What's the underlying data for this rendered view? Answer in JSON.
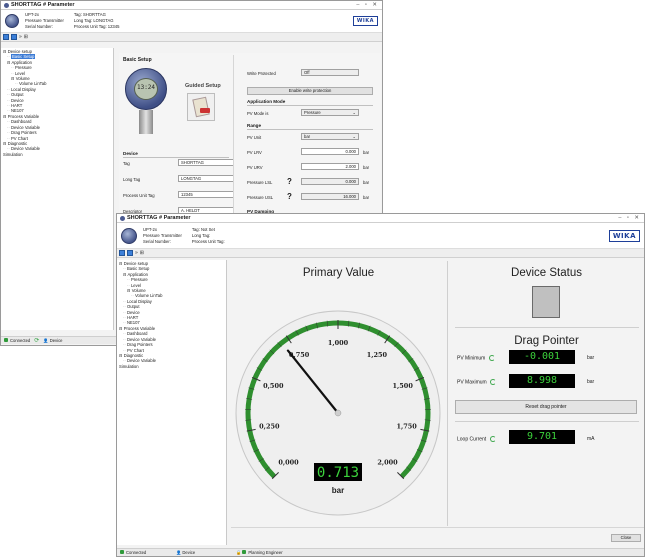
{
  "back_window": {
    "title": "SHORTTAG # Parameter",
    "header": {
      "model": "UPT-2x",
      "type": "Pressure Transmitter",
      "serial_label": "Serial Number:",
      "tag": "Tag: SHORTTAG",
      "long_tag": "Long Tag: LONGTAG",
      "process_unit_tag": "Process Unit Tag: 12345",
      "brand": "WIKA"
    },
    "tree": [
      {
        "label": "Device setup",
        "indent": 0,
        "prefix": "⊟"
      },
      {
        "label": "Basic Setup",
        "indent": 1,
        "prefix": "",
        "selected": true
      },
      {
        "label": "Application",
        "indent": 1,
        "prefix": "⊟"
      },
      {
        "label": "Pressure",
        "indent": 2,
        "prefix": ""
      },
      {
        "label": "Level",
        "indent": 2,
        "prefix": ""
      },
      {
        "label": "Volume",
        "indent": 2,
        "prefix": "⊟"
      },
      {
        "label": "Volume LinTab",
        "indent": 3,
        "prefix": ""
      },
      {
        "label": "Local Display",
        "indent": 1,
        "prefix": ""
      },
      {
        "label": "Output",
        "indent": 1,
        "prefix": ""
      },
      {
        "label": "Device",
        "indent": 1,
        "prefix": ""
      },
      {
        "label": "HART",
        "indent": 1,
        "prefix": ""
      },
      {
        "label": "NE107",
        "indent": 1,
        "prefix": ""
      },
      {
        "label": "Process Variable",
        "indent": 0,
        "prefix": "⊟"
      },
      {
        "label": "Dashboard",
        "indent": 1,
        "prefix": ""
      },
      {
        "label": "Device Variable",
        "indent": 1,
        "prefix": ""
      },
      {
        "label": "Drag Pointers",
        "indent": 1,
        "prefix": ""
      },
      {
        "label": "PV Chart",
        "indent": 1,
        "prefix": ""
      },
      {
        "label": "Diagnostic",
        "indent": 0,
        "prefix": "⊟"
      },
      {
        "label": "Device Variable",
        "indent": 1,
        "prefix": ""
      },
      {
        "label": "Simulation",
        "indent": 0,
        "prefix": ""
      }
    ],
    "basic_setup_title": "Basic Setup",
    "guided_setup_label": "Guided Setup",
    "device_section": "Device",
    "device_fields": [
      {
        "label": "Tag",
        "value": "SHORTTAG"
      },
      {
        "label": "Long Tag",
        "value": "LONGTAG"
      },
      {
        "label": "Process Unit Tag",
        "value": "12345"
      },
      {
        "label": "Descriptor",
        "value": "A. HELDT"
      }
    ],
    "write_protected_label": "Write Protected",
    "write_protected_value": "Off",
    "enable_write_protection": "Enable write protection",
    "app_mode_section": "Application Mode",
    "pv_mode_label": "PV Mode is",
    "pv_mode_value": "Pressure",
    "range_section": "Range",
    "range_fields": [
      {
        "label": "PV Unit",
        "value": "bar",
        "unit": "",
        "type": "select"
      },
      {
        "label": "PV LRV",
        "value": "0.000",
        "unit": "bar",
        "type": "input"
      },
      {
        "label": "PV URV",
        "value": "2.000",
        "unit": "bar",
        "type": "input"
      },
      {
        "label": "Pressure LSL",
        "value": "0.000",
        "unit": "bar",
        "type": "readonly"
      },
      {
        "label": "Pressure USL",
        "value": "16.000",
        "unit": "bar",
        "type": "readonly"
      }
    ],
    "pv_damping_label": "PV Damping",
    "lcd_value": "13:24",
    "status": {
      "connected": "Connected",
      "device": "Device"
    }
  },
  "front_window": {
    "title": "SHORTTAG # Parameter",
    "header": {
      "model": "UPT-2x",
      "type": "Pressure Transmitter",
      "serial_label": "Serial Number:",
      "tag": "Tag: Not Set",
      "long_tag": "Long Tag:",
      "process_unit_tag": "Process Unit Tag:",
      "brand": "WIKA"
    },
    "tree": [
      {
        "label": "Device setup",
        "indent": 0,
        "prefix": "⊟"
      },
      {
        "label": "Basic Setup",
        "indent": 1,
        "prefix": ""
      },
      {
        "label": "Application",
        "indent": 1,
        "prefix": "⊟"
      },
      {
        "label": "Pressure",
        "indent": 2,
        "prefix": ""
      },
      {
        "label": "Level",
        "indent": 2,
        "prefix": ""
      },
      {
        "label": "Volume",
        "indent": 2,
        "prefix": "⊟"
      },
      {
        "label": "Volume LinTab",
        "indent": 3,
        "prefix": ""
      },
      {
        "label": "Local Display",
        "indent": 1,
        "prefix": ""
      },
      {
        "label": "Output",
        "indent": 1,
        "prefix": ""
      },
      {
        "label": "Device",
        "indent": 1,
        "prefix": ""
      },
      {
        "label": "HART",
        "indent": 1,
        "prefix": ""
      },
      {
        "label": "NE107",
        "indent": 1,
        "prefix": ""
      },
      {
        "label": "Process Variable",
        "indent": 0,
        "prefix": "⊟"
      },
      {
        "label": "Dashboard",
        "indent": 1,
        "prefix": ""
      },
      {
        "label": "Device Variable",
        "indent": 1,
        "prefix": ""
      },
      {
        "label": "Drag Pointers",
        "indent": 1,
        "prefix": ""
      },
      {
        "label": "PV Chart",
        "indent": 1,
        "prefix": ""
      },
      {
        "label": "Diagnostic",
        "indent": 0,
        "prefix": "⊟"
      },
      {
        "label": "Device Variable",
        "indent": 1,
        "prefix": ""
      },
      {
        "label": "Simulation",
        "indent": 0,
        "prefix": ""
      }
    ],
    "gauge": {
      "title": "Primary Value",
      "value": 0.713,
      "value_text": "0.713",
      "unit": "bar",
      "min": 0,
      "max": 2,
      "tick_labels": [
        "0,000",
        "0,250",
        "0,500",
        "0,750",
        "1,000",
        "1,250",
        "1,500",
        "1,750",
        "2,000"
      ]
    },
    "device_status_title": "Device Status",
    "drag_pointer_title": "Drag Pointer",
    "pv_minimum_label": "PV Minimum",
    "pv_minimum_value": "-0.001",
    "pv_minimum_unit": "bar",
    "pv_maximum_label": "PV Maximum",
    "pv_maximum_value": "8.998",
    "pv_maximum_unit": "bar",
    "reset_label": "Reset drag pointer",
    "loop_current_label": "Loop Current",
    "loop_current_value": "9.701",
    "loop_current_unit": "mA",
    "close_label": "Close",
    "status": {
      "connected": "Connected",
      "device": "Device",
      "role": "Planning Engineer"
    },
    "colors": {
      "gauge_arc": "#2f8f2f",
      "digital_text": "#3cd33c",
      "status_box": "#c0c0c0"
    }
  }
}
